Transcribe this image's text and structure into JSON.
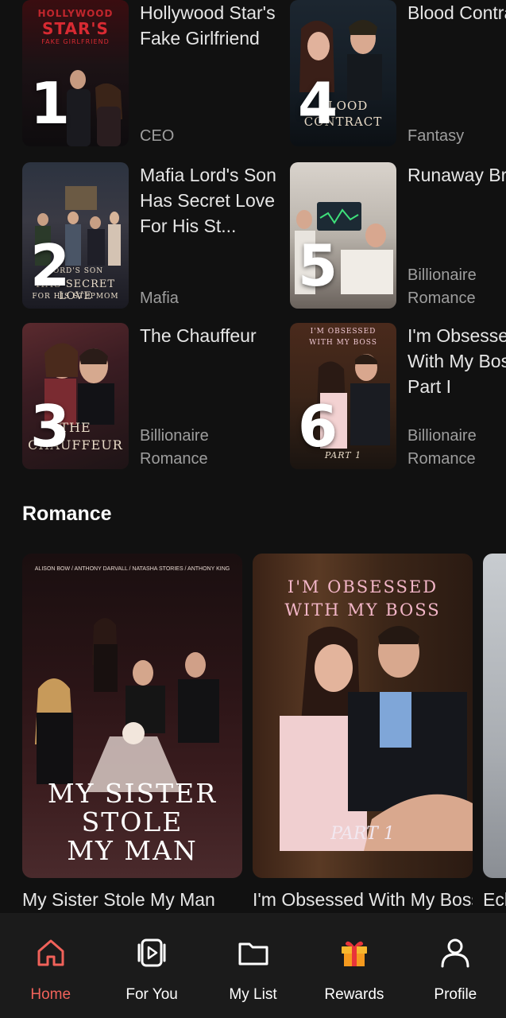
{
  "ranked": [
    {
      "rank": "1",
      "title": "Hollywood Star's Fake Girlfriend",
      "genre": "CEO",
      "cover_text": [
        "HOLLYWOOD",
        "STAR'S",
        "FAKE GIRLFRIEND"
      ]
    },
    {
      "rank": "2",
      "title": "Mafia Lord's Son Has Secret Love For His St...",
      "genre": "Mafia",
      "cover_text": [
        "LORD'S SON",
        "HAS SECRET LOVE",
        "FOR HIS STEPMOM"
      ]
    },
    {
      "rank": "3",
      "title": "The Chauffeur",
      "genre": "Billionaire Romance",
      "cover_text": [
        "THE",
        "CHAUFFEUR"
      ]
    },
    {
      "rank": "4",
      "title": "Blood Contract",
      "genre": "Fantasy",
      "cover_text": [
        "BLOOD",
        "CONTRACT"
      ]
    },
    {
      "rank": "5",
      "title": "Runaway Bride",
      "genre": "Billionaire Romance",
      "cover_text": []
    },
    {
      "rank": "6",
      "title": "I'm Obsessed With My Boss Part I",
      "genre": "Billionaire Romance",
      "cover_text": [
        "I'M OBSESSED",
        "WITH MY BOSS",
        "PART 1"
      ]
    }
  ],
  "section": {
    "title": "Romance"
  },
  "posters": [
    {
      "title": "My Sister Stole My Man",
      "credits": "ALISON BOW / ANTHONY DARVALL / NATASHA STORIES / ANTHONY KING",
      "cover_lines": [
        "MY SISTER",
        "STOLE",
        "MY MAN"
      ]
    },
    {
      "title": "I'm Obsessed With My Boss",
      "cover_lines": [
        "I'M OBSESSED",
        "WITH MY BOSS",
        "PART 1"
      ]
    },
    {
      "title": "Echo"
    }
  ],
  "nav": {
    "items": [
      {
        "label": "Home",
        "icon": "home-icon",
        "active": true
      },
      {
        "label": "For You",
        "icon": "play-video-icon",
        "active": false
      },
      {
        "label": "My List",
        "icon": "folder-icon",
        "active": false
      },
      {
        "label": "Rewards",
        "icon": "gift-icon",
        "active": false
      },
      {
        "label": "Profile",
        "icon": "person-icon",
        "active": false
      }
    ],
    "active_color": "#f0625a"
  }
}
